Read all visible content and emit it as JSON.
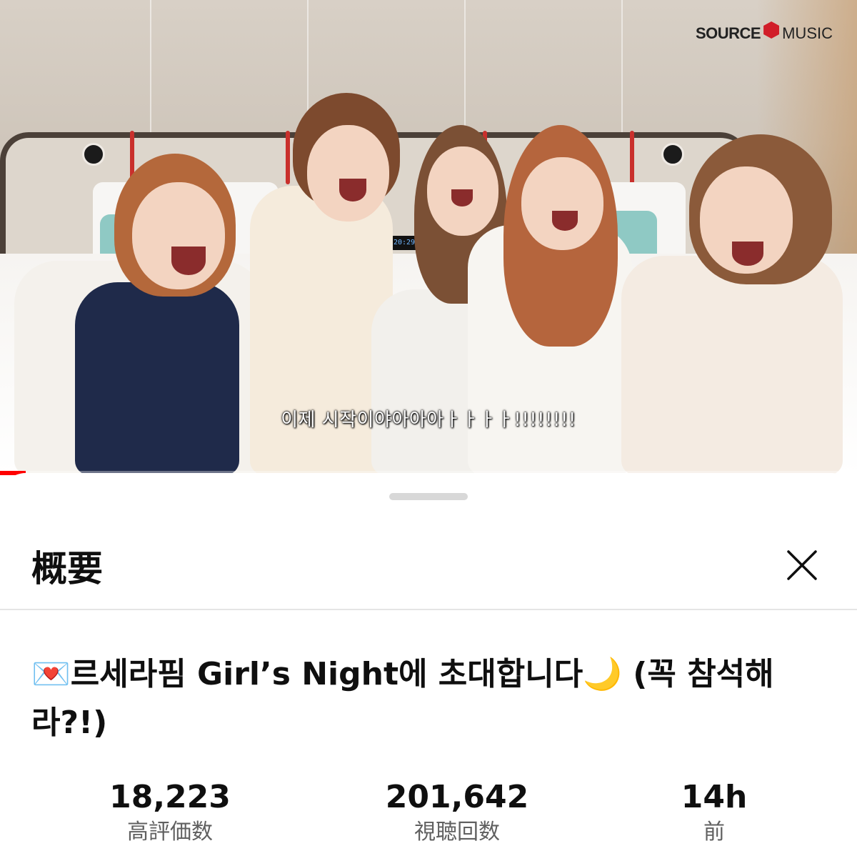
{
  "video": {
    "channel_logo": {
      "brand_bold": "SOURCE",
      "brand_regular": "MUSIC",
      "mark_color": "#d11e29"
    },
    "clock_display": "20:29",
    "caption": "이제 시작이야아아아ㅏㅏㅏㅏ!!!!!!!!",
    "progress": 0.03,
    "progress_color": "#ff0000"
  },
  "sheet": {
    "title": "概要",
    "close_icon": "close-x-icon",
    "video_title": "💌르세라핌 Girl’s Night에 초대합니다🌙 (꼭 참석해라?!)",
    "stats": [
      {
        "value": "18,223",
        "label": "高評価数"
      },
      {
        "value": "201,642",
        "label": "視聴回数"
      },
      {
        "value": "14h",
        "label": "前"
      }
    ]
  }
}
